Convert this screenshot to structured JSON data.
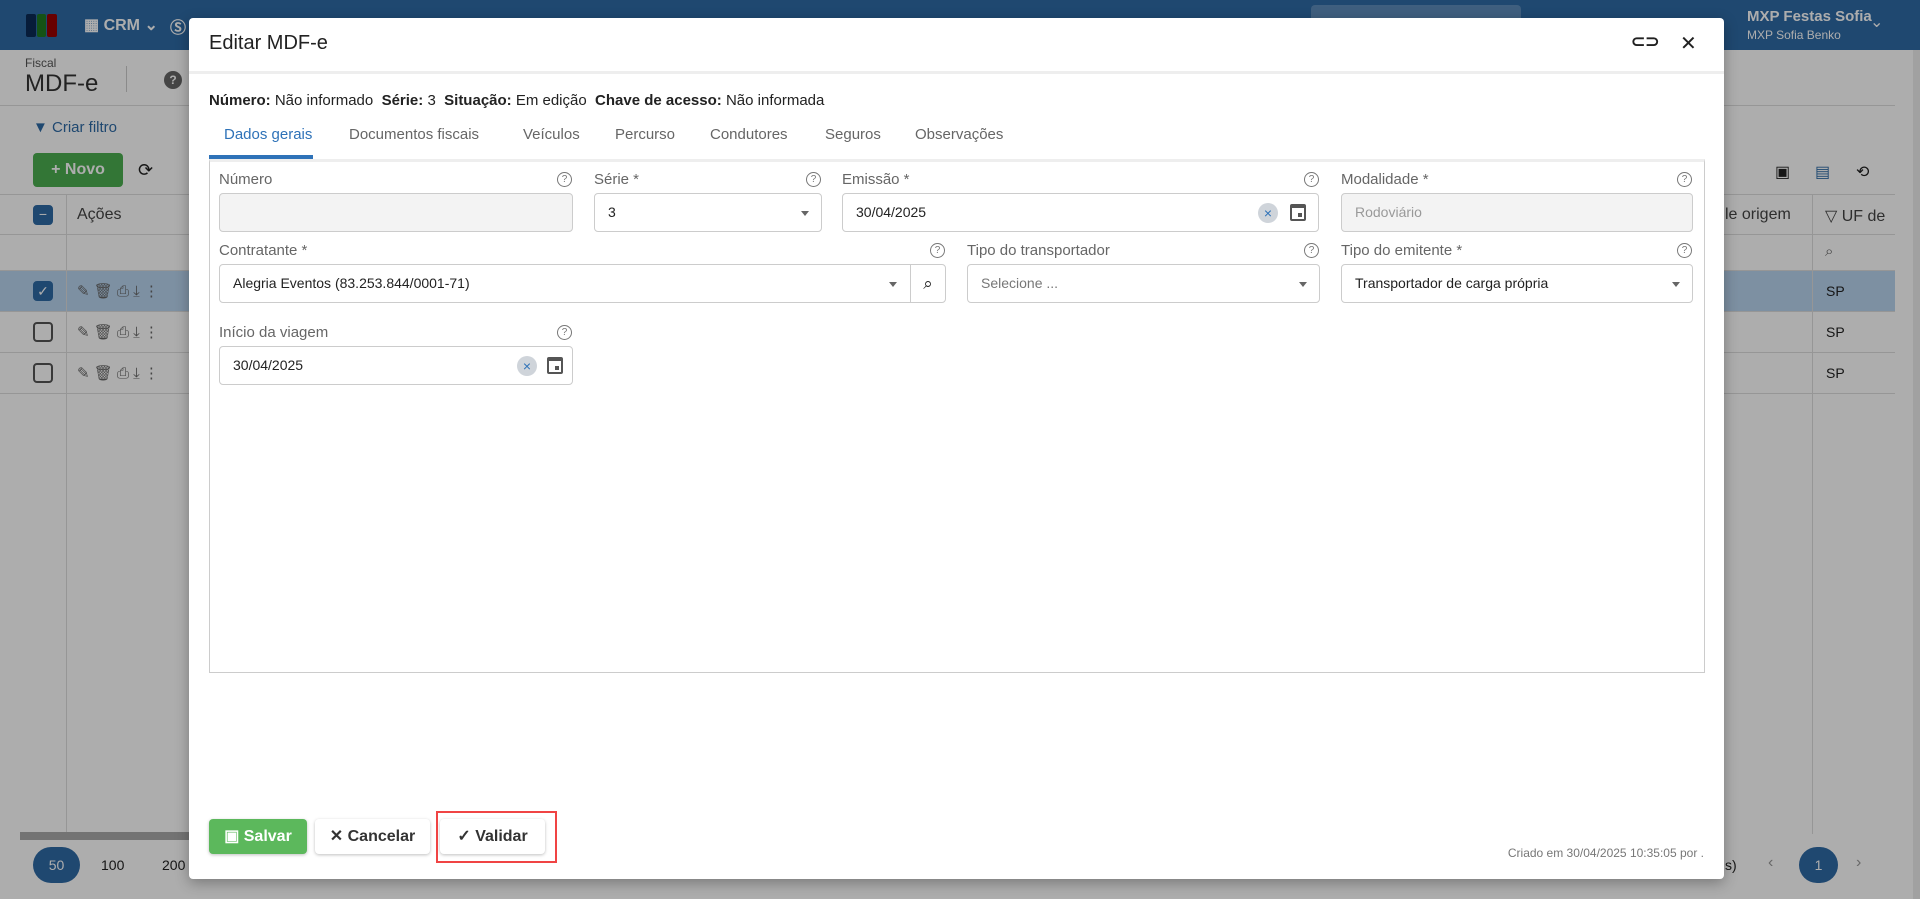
{
  "app": {
    "module": "CRM",
    "user_company": "MXP Festas Sofia",
    "user_name": "MXP Sofia Benko",
    "breadcrumb_section": "Fiscal",
    "page_title": "MDF-e",
    "create_filter": "Criar filtro",
    "new_button": "Novo",
    "table": {
      "col_actions": "Ações",
      "col_origin": "le origem",
      "col_uf": "UF de",
      "rows": [
        {
          "uf": "SP",
          "checked": true
        },
        {
          "uf": "SP",
          "checked": false
        },
        {
          "uf": "SP",
          "checked": false
        }
      ]
    },
    "pagination": {
      "sizes": [
        "50",
        "100",
        "200"
      ],
      "suffix": "s)",
      "current_page": "1"
    }
  },
  "modal": {
    "title": "Editar MDF-e",
    "info": {
      "numero_label": "Número:",
      "numero_value": "Não informado",
      "serie_label": "Série:",
      "serie_value": "3",
      "situacao_label": "Situação:",
      "situacao_value": "Em edição",
      "chave_label": "Chave de acesso:",
      "chave_value": "Não informada"
    },
    "tabs": [
      "Dados gerais",
      "Documentos fiscais",
      "Veículos",
      "Percurso",
      "Condutores",
      "Seguros",
      "Observações"
    ],
    "fields": {
      "numero": {
        "label": "Número",
        "value": ""
      },
      "serie": {
        "label": "Série *",
        "value": "3"
      },
      "emissao": {
        "label": "Emissão *",
        "value": "30/04/2025"
      },
      "modalidade": {
        "label": "Modalidade *",
        "value": "Rodoviário"
      },
      "contratante": {
        "label": "Contratante *",
        "value": "Alegria Eventos (83.253.844/0001-71)"
      },
      "tipo_transportador": {
        "label": "Tipo do transportador",
        "placeholder": "Selecione ..."
      },
      "tipo_emitente": {
        "label": "Tipo do emitente *",
        "value": "Transportador de carga própria"
      },
      "inicio_viagem": {
        "label": "Início da viagem",
        "value": "30/04/2025"
      }
    },
    "buttons": {
      "save": "Salvar",
      "cancel": "Cancelar",
      "validate": "Validar"
    },
    "created": "Criado em 30/04/2025 10:35:05 por ."
  }
}
